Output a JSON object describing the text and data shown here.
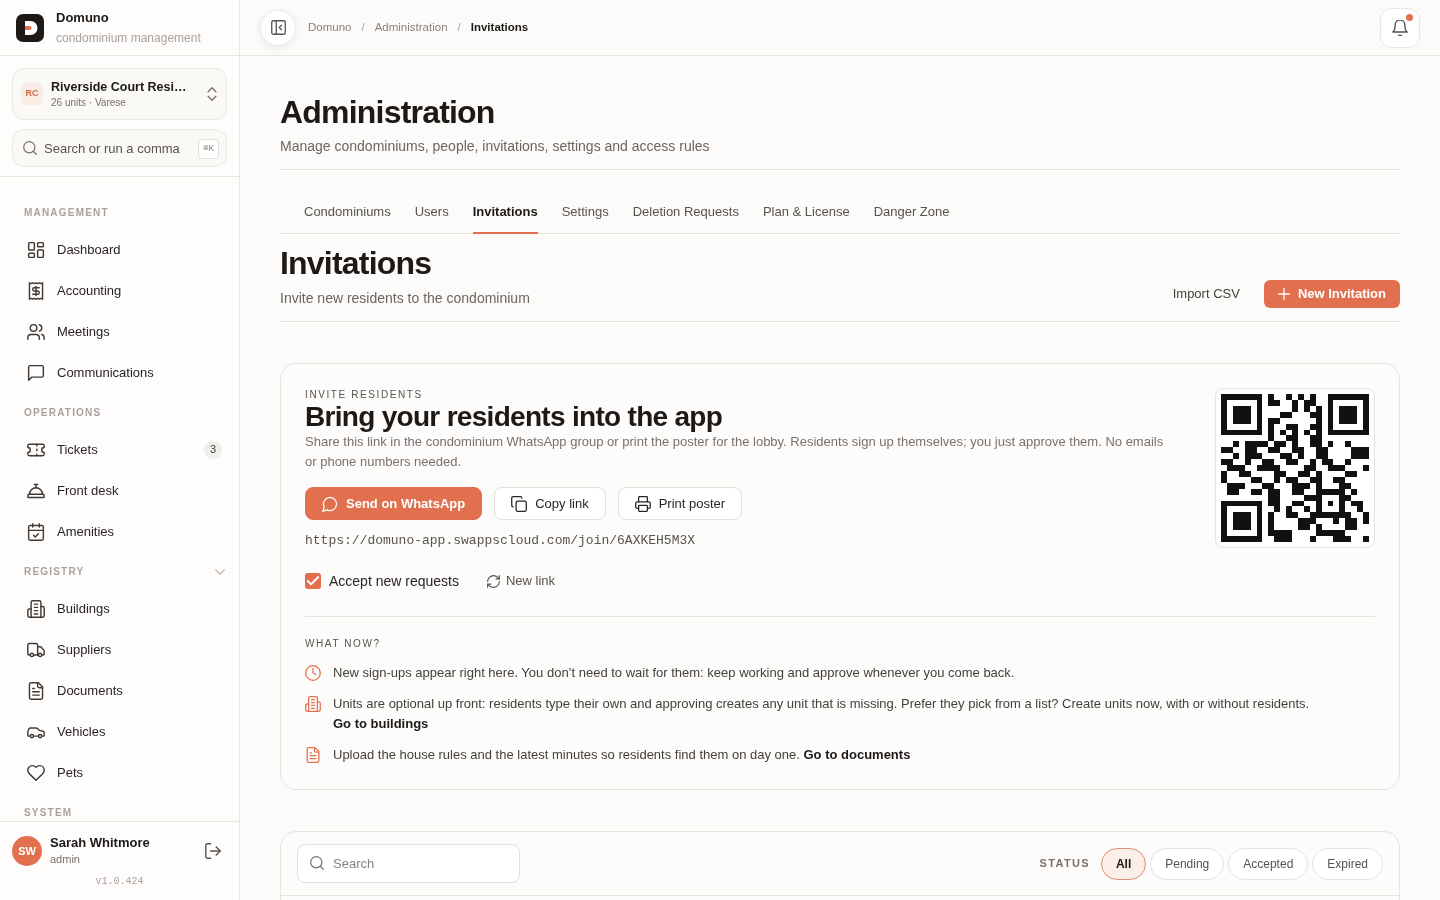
{
  "app": {
    "name": "Domuno",
    "tagline": "condominium management"
  },
  "condo_switcher": {
    "initials": "RC",
    "name": "Riverside Court Resi…",
    "details": "26 units · Varese"
  },
  "command_search": {
    "placeholder": "Search or run a comma",
    "shortcut": "⌘K"
  },
  "sidebar": {
    "sections": [
      {
        "label": "MANAGEMENT",
        "kind": "group",
        "items": [
          {
            "label": "Dashboard"
          },
          {
            "label": "Accounting"
          },
          {
            "label": "Meetings"
          },
          {
            "label": "Communications"
          }
        ]
      },
      {
        "label": "OPERATIONS",
        "kind": "group",
        "items": [
          {
            "label": "Tickets",
            "badge": "3"
          },
          {
            "label": "Front desk"
          },
          {
            "label": "Amenities"
          }
        ]
      },
      {
        "label": "REGISTRY",
        "kind": "collapsible",
        "expanded": true,
        "items": [
          {
            "label": "Buildings"
          },
          {
            "label": "Suppliers"
          },
          {
            "label": "Documents"
          },
          {
            "label": "Vehicles"
          },
          {
            "label": "Pets"
          }
        ]
      },
      {
        "label": "SYSTEM",
        "kind": "group"
      }
    ]
  },
  "user": {
    "initials": "SW",
    "name": "Sarah Whitmore",
    "role": "admin"
  },
  "version": "v1.0.424",
  "breadcrumb": [
    {
      "label": "Domuno",
      "selected": false
    },
    {
      "separator": "/",
      "label": "Administration",
      "selected": false
    },
    {
      "separator": "/",
      "label": "Invitations",
      "selected": true
    }
  ],
  "notifications": {
    "unread": true
  },
  "page": {
    "title": "Administration",
    "subtitle": "Manage condominiums, people, invitations, settings and access rules"
  },
  "tabs": [
    {
      "label": "Condominiums",
      "selected": false
    },
    {
      "label": "Users",
      "selected": false
    },
    {
      "label": "Invitations",
      "selected": true
    },
    {
      "label": "Settings",
      "selected": false
    },
    {
      "label": "Deletion Requests",
      "selected": false
    },
    {
      "label": "Plan & License",
      "selected": false
    },
    {
      "label": "Danger Zone",
      "selected": false
    }
  ],
  "section_header": {
    "title": "Invitations",
    "subtitle": "Invite new residents to the condominium",
    "actions": [
      {
        "label": "Import CSV",
        "kind": "text"
      },
      {
        "label": "New Invitation",
        "kind": "primary"
      }
    ]
  },
  "invite_card": {
    "eyebrow": "INVITE RESIDENTS",
    "title": "Bring your residents into the app",
    "description": "Share this link in the condominium WhatsApp group or print the poster for the lobby. Residents sign up themselves; you just approve them. No emails or phone numbers needed.",
    "buttons": [
      {
        "label": "Send on WhatsApp",
        "kind": "primary"
      },
      {
        "label": "Copy link",
        "kind": "outline"
      },
      {
        "label": "Print poster",
        "kind": "outline"
      }
    ],
    "link": "https://domuno-app.swappscloud.com/join/6AXKEH5M3X",
    "accept_requests": {
      "label": "Accept new requests",
      "checked": true
    },
    "new_link": "New link",
    "what_now": {
      "heading": "WHAT NOW?",
      "items": [
        {
          "text": "New sign-ups appear right here. You don’t need to wait for them: keep working and approve whenever you come back."
        },
        {
          "text": "Units are optional up front: residents type their own and approving creates any unit that is missing. Prefer they pick from a list? Create units now, with or without residents.",
          "link": "Go to buildings"
        },
        {
          "text": "Upload the house rules and the latest minutes so residents find them on day one.",
          "link": "Go to documents"
        }
      ]
    }
  },
  "invitations_filter": {
    "search_placeholder": "Search",
    "status_label": "STATUS",
    "options": [
      {
        "label": "All",
        "selected": true
      },
      {
        "label": "Pending",
        "selected": false
      },
      {
        "label": "Accepted",
        "selected": false
      },
      {
        "label": "Expired",
        "selected": false
      }
    ]
  }
}
